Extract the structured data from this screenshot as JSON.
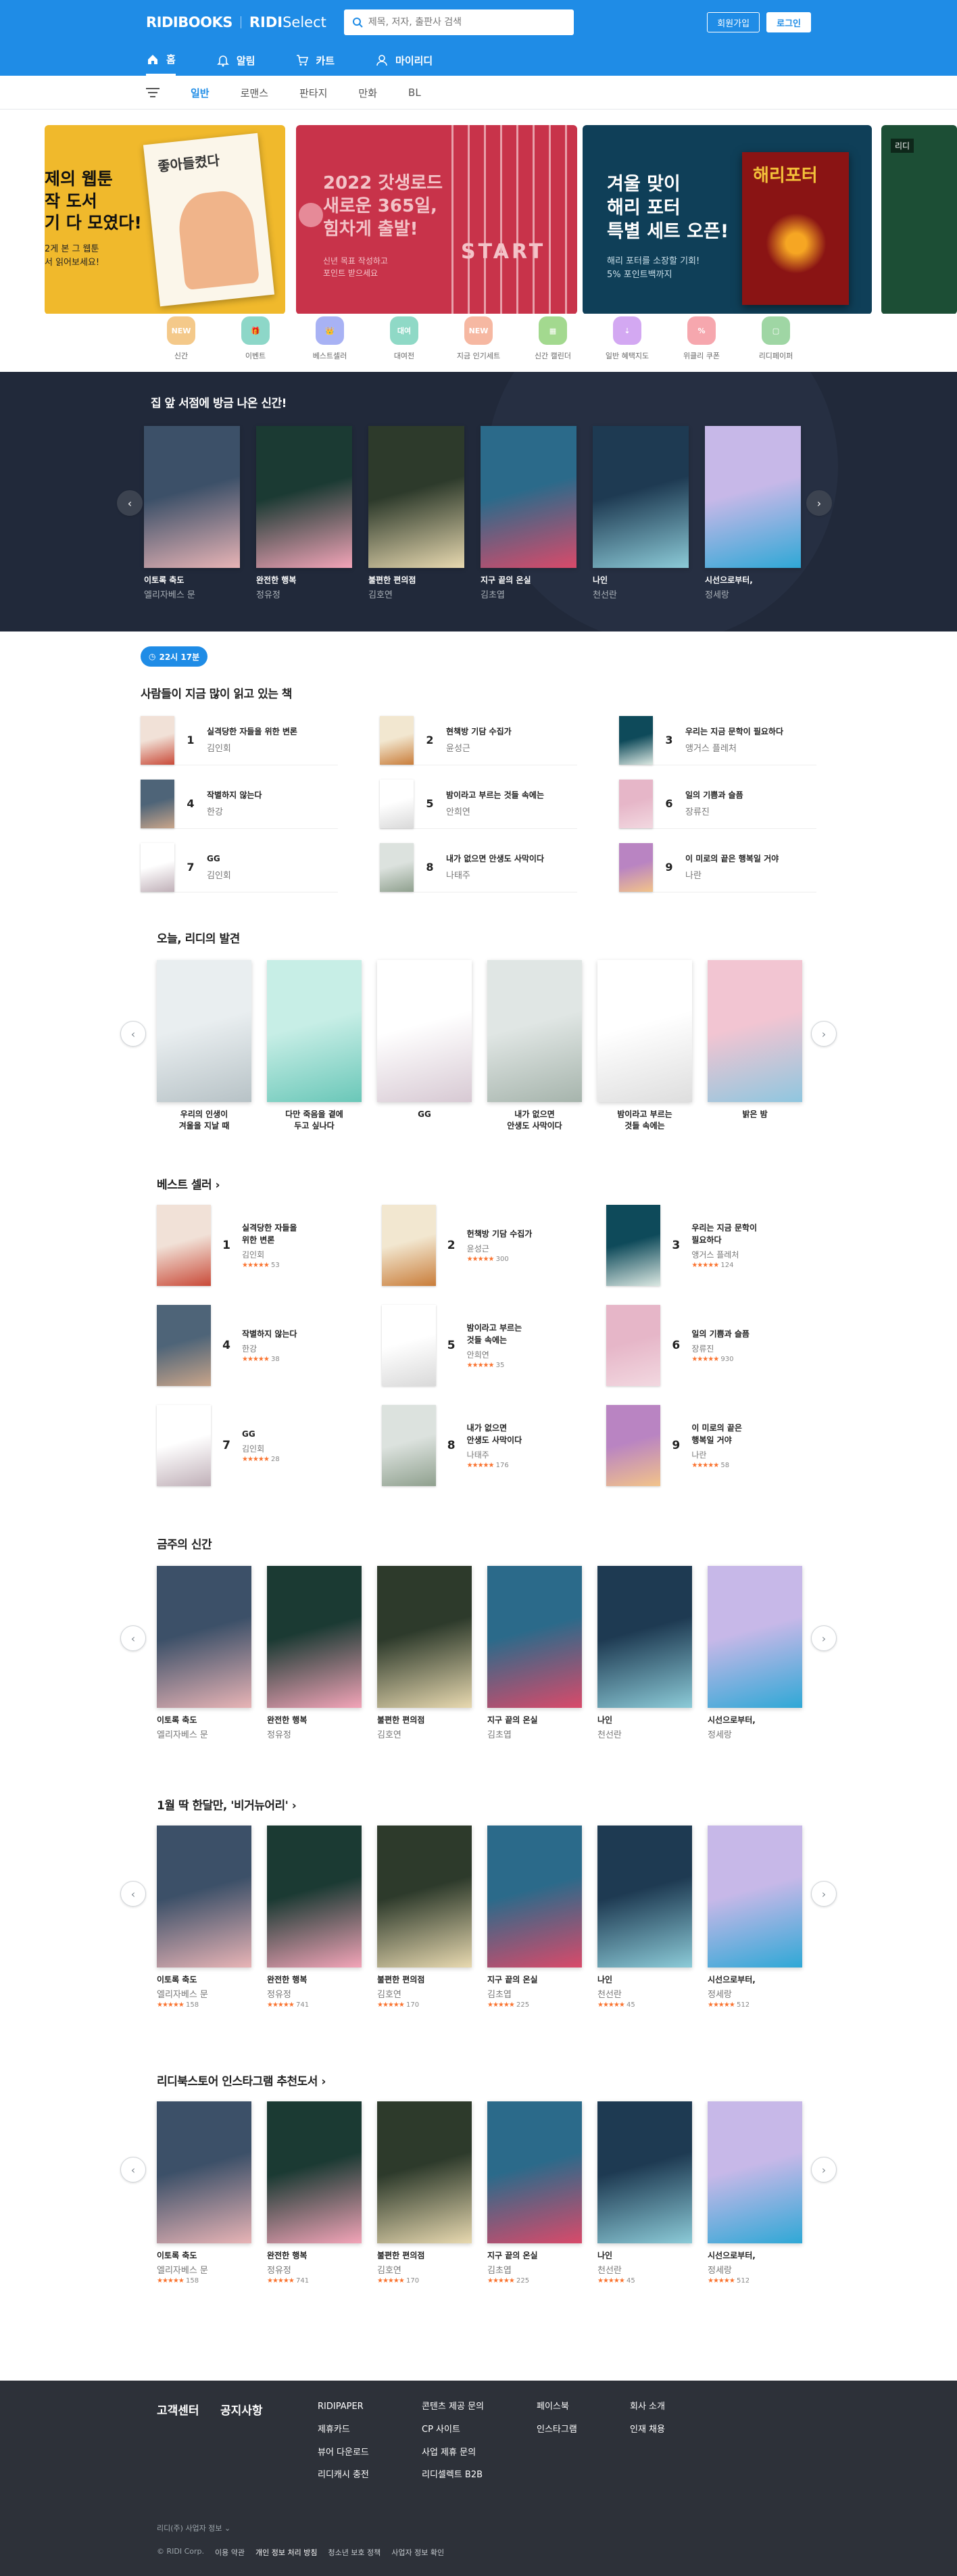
{
  "header": {
    "logo": "RIDIBOOKS",
    "logo2_bold": "RIDI",
    "logo2_light": "Select",
    "search_placeholder": "제목, 저자, 출판사 검색",
    "signup": "회원가입",
    "login": "로그인",
    "nav": [
      {
        "label": "홈",
        "icon": "home-icon"
      },
      {
        "label": "알림",
        "icon": "bell-icon"
      },
      {
        "label": "카트",
        "icon": "cart-icon"
      },
      {
        "label": "마이리디",
        "icon": "user-icon"
      }
    ]
  },
  "categories": [
    "일반",
    "로맨스",
    "판타지",
    "만화",
    "BL"
  ],
  "banners": [
    {
      "title": "제의 웹툰\n작 도서\n기 다 모였다!",
      "sub": "2게 본 그 웹툰\n서 읽어보세요!",
      "book": "좋아들켰다",
      "color": "#f0b92c"
    },
    {
      "title": "2022 갓생로드\n새로운 365일,\n힘차게 출발!",
      "sub": "신년 목표 작성하고\n포인트 받으세요",
      "book": "START",
      "color": "#c8334a"
    },
    {
      "title": "겨울 맞이\n해리 포터\n특별 세트 오픈!",
      "sub": "해리 포터를 소장할 기회!\n5% 포인트백까지",
      "book": "해리포터",
      "color": "#0f3f58"
    },
    {
      "title": "리디",
      "color": "#1c4e35"
    }
  ],
  "quick_menu": [
    {
      "label": "신간",
      "badge": "NEW",
      "color": "#f4c98a"
    },
    {
      "label": "이벤트",
      "badge": "🎁",
      "color": "#8dd7c8"
    },
    {
      "label": "베스트셀러",
      "badge": "👑",
      "color": "#a8b2f4"
    },
    {
      "label": "대여전",
      "badge": "대여",
      "color": "#8fd9c6"
    },
    {
      "label": "지금 인기세트",
      "badge": "NEW",
      "color": "#f6b8a2"
    },
    {
      "label": "신간 캘린더",
      "badge": "▦",
      "color": "#a3d98f"
    },
    {
      "label": "일반 혜택지도",
      "badge": "⇣",
      "color": "#d3a8f2"
    },
    {
      "label": "위클리 쿠폰",
      "badge": "%",
      "color": "#f6a7ae"
    },
    {
      "label": "리디페이퍼",
      "badge": "▢",
      "color": "#9fd6a4"
    }
  ],
  "new_books_section": {
    "title": "집 앞 서점에 방금 나온 신간!"
  },
  "books": [
    {
      "title": "이토록 축도",
      "author": "엘리자베스 문",
      "rating": "158",
      "palette": [
        "#3c5068",
        "#e8b4b6"
      ]
    },
    {
      "title": "완전한 행복",
      "author": "정유정",
      "rating": "741",
      "palette": [
        "#1b3a33",
        "#f3a4b8"
      ]
    },
    {
      "title": "불편한 편의점",
      "author": "김호연",
      "rating": "170",
      "palette": [
        "#2d3a2b",
        "#e8d9b0"
      ]
    },
    {
      "title": "지구 끝의 온실",
      "author": "김초엽",
      "rating": "225",
      "palette": [
        "#2b6a8a",
        "#d94a6a"
      ]
    },
    {
      "title": "나인",
      "author": "천선란",
      "rating": "45",
      "palette": [
        "#1e3a52",
        "#8ccbd8"
      ]
    },
    {
      "title": "시선으로부터,",
      "author": "정세랑",
      "rating": "512",
      "palette": [
        "#c7b8e8",
        "#2fa8d6"
      ]
    }
  ],
  "realtime": {
    "badge": "22시 17분",
    "title": "사람들이 지금 많이 읽고 있는 책",
    "items": [
      {
        "rank": "1",
        "title": "실격당한 자들을 위한 변론",
        "author": "김인회",
        "palette": [
          "#f1e1d7",
          "#c94a38"
        ]
      },
      {
        "rank": "2",
        "title": "현책방 기담 수집가",
        "author": "윤성근",
        "palette": [
          "#f2e7d0",
          "#c97d3a"
        ]
      },
      {
        "rank": "3",
        "title": "우리는 지금 문학이 필요하다",
        "author": "앵거스 플레처",
        "palette": [
          "#0e4a5a",
          "#dbe8e2"
        ]
      },
      {
        "rank": "4",
        "title": "작별하지 않는다",
        "author": "한강",
        "palette": [
          "#4e6478",
          "#c9a58a"
        ]
      },
      {
        "rank": "5",
        "title": "밤이라고 부르는 것들 속에는",
        "author": "안희연",
        "palette": [
          "#ffffff",
          "#d9d9d9"
        ]
      },
      {
        "rank": "6",
        "title": "일의 기쁨과 슬픔",
        "author": "장류진",
        "palette": [
          "#e6b6c8",
          "#f2d8e0"
        ]
      },
      {
        "rank": "7",
        "title": "GG",
        "author": "김인회",
        "palette": [
          "#ffffff",
          "#c0b0b8"
        ]
      },
      {
        "rank": "8",
        "title": "내가 없으면 안생도 사막이다",
        "author": "나태주",
        "palette": [
          "#dce2de",
          "#8fa08e"
        ]
      },
      {
        "rank": "9",
        "title": "이 미로의 끝은 행복일 거야",
        "author": "나란",
        "palette": [
          "#b984c2",
          "#f2c38a"
        ]
      }
    ]
  },
  "discovery": {
    "title": "오늘, 리디의 발견",
    "items": [
      {
        "title": "우리의 인생이\n겨울을 지날 때",
        "palette": [
          "#e9eef0",
          "#b7c2c6"
        ]
      },
      {
        "title": "다만 죽음을 곁에\n두고 싶나다",
        "palette": [
          "#c7eee6",
          "#6ac7b8"
        ]
      },
      {
        "title": "GG",
        "palette": [
          "#ffffff",
          "#d7c9d3"
        ]
      },
      {
        "title": "내가 없으면\n안생도 사막이다",
        "palette": [
          "#e0e6e4",
          "#a6b4ac"
        ]
      },
      {
        "title": "밤이라고 부르는\n것들 속에는",
        "palette": [
          "#ffffff",
          "#dedede"
        ]
      },
      {
        "title": "밝은 밤",
        "palette": [
          "#f2c5d2",
          "#8fc6df"
        ]
      }
    ]
  },
  "bestseller": {
    "title": "베스트 셀러",
    "items": [
      {
        "rank": "1",
        "title": "실격당한 자들을\n위한 변론",
        "author": "김인회",
        "rating": "53",
        "palette": [
          "#f1e1d7",
          "#c94a38"
        ]
      },
      {
        "rank": "2",
        "title": "헌책방 기담 수집가",
        "author": "윤성근",
        "rating": "300",
        "palette": [
          "#f2e7d0",
          "#c97d3a"
        ]
      },
      {
        "rank": "3",
        "title": "우리는 지금 문학이\n필요하다",
        "author": "앵거스 플레처",
        "rating": "124",
        "palette": [
          "#0e4a5a",
          "#dbe8e2"
        ]
      },
      {
        "rank": "4",
        "title": "작별하지 않는다",
        "author": "한강",
        "rating": "38",
        "palette": [
          "#4e6478",
          "#c9a58a"
        ]
      },
      {
        "rank": "5",
        "title": "밤이라고 부르는\n것들 속에는",
        "author": "안희연",
        "rating": "35",
        "palette": [
          "#ffffff",
          "#d9d9d9"
        ]
      },
      {
        "rank": "6",
        "title": "일의 기쁨과 슬픔",
        "author": "장류진",
        "rating": "930",
        "palette": [
          "#e6b6c8",
          "#f2d8e0"
        ]
      },
      {
        "rank": "7",
        "title": "GG",
        "author": "김인회",
        "rating": "28",
        "palette": [
          "#ffffff",
          "#c0b0b8"
        ]
      },
      {
        "rank": "8",
        "title": "내가 없으면\n안생도 사막이다",
        "author": "나태주",
        "rating": "176",
        "palette": [
          "#dce2de",
          "#8fa08e"
        ]
      },
      {
        "rank": "9",
        "title": "이 미로의 끝은\n행복일 거야",
        "author": "나란",
        "rating": "58",
        "palette": [
          "#b984c2",
          "#f2c38a"
        ]
      }
    ]
  },
  "weekly_new": {
    "title": "금주의 신간"
  },
  "monthly": {
    "title": "1월 딱 한달만, '비거뉴어리'"
  },
  "instagram": {
    "title": "리디북스토어 인스타그램 추천도서"
  },
  "footer": {
    "customer_center": "고객센터",
    "notice": "공지사항",
    "col1": [
      "RIDIPAPER",
      "제휴카드",
      "뷰어 다운로드",
      "리디캐시 충전"
    ],
    "col2": [
      "콘텐츠 제공 문의",
      "CP 사이트",
      "사업 제휴 문의",
      "리디셀렉트 B2B"
    ],
    "col3": [
      "페이스북",
      "인스타그램"
    ],
    "col4": [
      "회사 소개",
      "인재 채용"
    ],
    "company_info": "리디(주) 사업자 정보",
    "copyright": "© RIDI Corp.",
    "links": [
      "이용 약관",
      "개인 정보 처리 방침",
      "청소년 보호 정책",
      "사업자 정보 확인"
    ]
  }
}
